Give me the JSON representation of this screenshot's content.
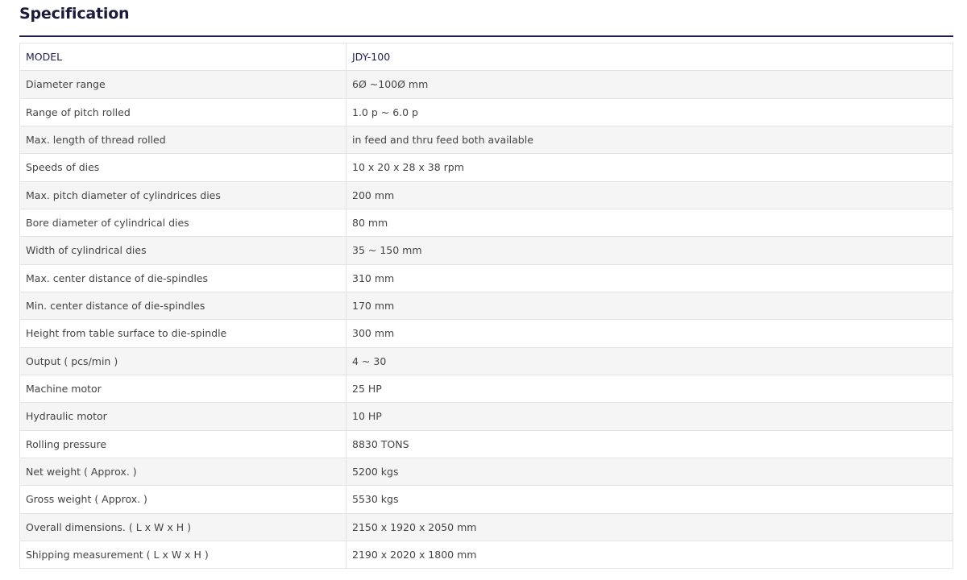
{
  "section": {
    "title": "Specification"
  },
  "spec_rows": [
    {
      "label": "MODEL",
      "value": "JDY-100"
    },
    {
      "label": "Diameter range",
      "value": "6Ø ~100Ø mm"
    },
    {
      "label": "Range of pitch rolled",
      "value": "1.0 p ~ 6.0 p"
    },
    {
      "label": "Max. length of thread rolled",
      "value": "in feed and thru feed both available"
    },
    {
      "label": "Speeds of dies",
      "value": "10 x 20 x 28 x 38 rpm"
    },
    {
      "label": "Max. pitch diameter of cylindrices dies",
      "value": "200 mm"
    },
    {
      "label": "Bore diameter of cylindrical dies",
      "value": "80 mm"
    },
    {
      "label": "Width of cylindrical dies",
      "value": "35 ~ 150 mm"
    },
    {
      "label": "Max. center distance of die-spindles",
      "value": "310 mm"
    },
    {
      "label": "Min. center distance of die-spindles",
      "value": "170 mm"
    },
    {
      "label": "Height from table surface to die-spindle",
      "value": "300 mm"
    },
    {
      "label": "Output ( pcs/min )",
      "value": "4 ~ 30"
    },
    {
      "label": "Machine motor",
      "value": "25 HP"
    },
    {
      "label": "Hydraulic motor",
      "value": "10 HP"
    },
    {
      "label": "Rolling pressure",
      "value": "8830 TONS"
    },
    {
      "label": "Net weight ( Approx. )",
      "value": "5200 kgs"
    },
    {
      "label": "Gross weight ( Approx. )",
      "value": "5530 kgs"
    },
    {
      "label": "Overall dimensions. ( L x W x H )",
      "value": "2150 x 1920 x 2050 mm"
    },
    {
      "label": "Shipping measurement ( L x W x H )",
      "value": "2190 x 2020 x 1800 mm"
    }
  ]
}
